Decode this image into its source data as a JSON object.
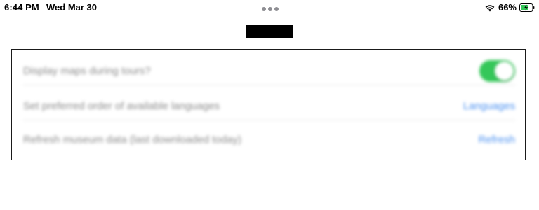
{
  "status_bar": {
    "time": "6:44 PM",
    "date": "Wed Mar 30",
    "battery_percent": "66%",
    "battery_level": 0.66,
    "charging": true,
    "wifi_icon": "wifi-icon",
    "battery_icon": "battery-charging-icon"
  },
  "settings": {
    "rows": [
      {
        "label": "Display maps during tours?",
        "control": "toggle",
        "toggle_on": true
      },
      {
        "label": "Set preferred order of available languages",
        "action": "Languages"
      },
      {
        "label": "Refresh museum data (last downloaded today)",
        "action": "Refresh"
      }
    ]
  },
  "colors": {
    "toggle_on": "#34c759",
    "link": "#4a90f0",
    "battery_fill": "#34c759"
  }
}
